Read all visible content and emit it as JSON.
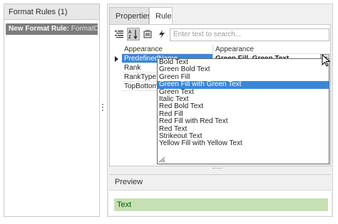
{
  "left_panel": {
    "header": "Format Rules (1)",
    "rule": {
      "name": "New Format Rule:",
      "target": "FormatCor"
    }
  },
  "tabs": [
    {
      "label": "Properties",
      "active": false
    },
    {
      "label": "Rule",
      "active": true
    }
  ],
  "toolbar": {
    "buttons": [
      "categorized-icon",
      "alphabetical-sort-icon",
      "property-pages-icon",
      "events-lightning-icon"
    ],
    "search_placeholder": "Enter text to search..."
  },
  "grid": {
    "header": {
      "name": "Appearance",
      "value": "Appearance"
    },
    "rows": [
      {
        "name": "PredefinedName",
        "value": "Green Fill, Green Text"
      },
      {
        "name": "Rank",
        "value": ""
      },
      {
        "name": "RankType",
        "value": ""
      },
      {
        "name": "TopBottom",
        "value": ""
      }
    ]
  },
  "dropdown": {
    "items": [
      "Bold Text",
      "Green Bold Text",
      "Green Fill",
      "Green Fill with Green Text",
      "Green Text",
      "Italic Text",
      "Red Bold Text",
      "Red Fill",
      "Red Fill with Red Text",
      "Red Text",
      "Strikeout Text",
      "Yellow Fill with Yellow Text"
    ],
    "highlighted_index": 3
  },
  "preview": {
    "label": "Preview",
    "sample_text": "Text",
    "fill_color": "#c6e0b4",
    "text_color": "#006100"
  },
  "colors": {
    "selection": "#3a87d6",
    "rule_item_bg": "#7d7d7d"
  }
}
